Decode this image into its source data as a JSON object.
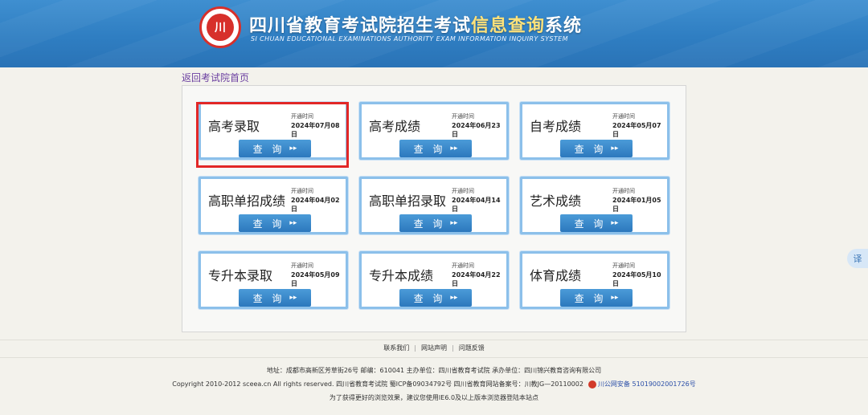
{
  "header": {
    "title_main": "四川省教育考试院招生考试",
    "title_highlight": "信息查询",
    "title_tail": "系统",
    "subtitle": "SI CHUAN EDUCATIONAL EXAMINATIONS AUTHORITY EXAM INFORMATION INQUIRY SYSTEM",
    "logo_text": "㉛"
  },
  "back_link": "返回考试院首页",
  "cards": [
    {
      "name": "高考录取",
      "open_label": "开通时间",
      "open_date": "2024年07月08日",
      "button": "查 询",
      "highlighted": true
    },
    {
      "name": "高考成绩",
      "open_label": "开通时间",
      "open_date": "2024年06月23日",
      "button": "查 询"
    },
    {
      "name": "自考成绩",
      "open_label": "开通时间",
      "open_date": "2024年05月07日",
      "button": "查 询"
    },
    {
      "name": "高职单招成绩",
      "open_label": "开通时间",
      "open_date": "2024年04月02日",
      "button": "查 询"
    },
    {
      "name": "高职单招录取",
      "open_label": "开通时间",
      "open_date": "2024年04月14日",
      "button": "查 询"
    },
    {
      "name": "艺术成绩",
      "open_label": "开通时间",
      "open_date": "2024年01月05日",
      "button": "查 询"
    },
    {
      "name": "专升本录取",
      "open_label": "开通时间",
      "open_date": "2024年05月09日",
      "button": "查 询"
    },
    {
      "name": "专升本成绩",
      "open_label": "开通时间",
      "open_date": "2024年04月22日",
      "button": "查 询"
    },
    {
      "name": "体育成绩",
      "open_label": "开通时间",
      "open_date": "2024年05月10日",
      "button": "查 询"
    }
  ],
  "button_arrow": "▸▸",
  "translate_label": "译",
  "footer": {
    "nav": [
      "联系我们",
      "网站声明",
      "问题反馈"
    ],
    "address_line": "地址：成都市高新区芳草街26号  邮编：610041      主办单位：四川省教育考试院  承办单位：四川锦兴教育咨询有限公司",
    "copyright_line": "Copyright 2010-2012 sceea.cn All rights reserved. 四川省教育考试院      蜀ICP备09034792号  四川省教育网站备案号：川教JG—20110002",
    "police_record": "川公网安备 51019002001726号",
    "browser_tip": "为了获得更好的浏览效果，建议您使用IE6.0及以上版本浏览器登陆本站点"
  },
  "colors": {
    "header_blue": "#2f7ec2",
    "card_border": "#8cc0ea",
    "button_blue": "#2c78bd",
    "highlight_red": "#e22727",
    "title_highlight": "#ffe27a"
  }
}
